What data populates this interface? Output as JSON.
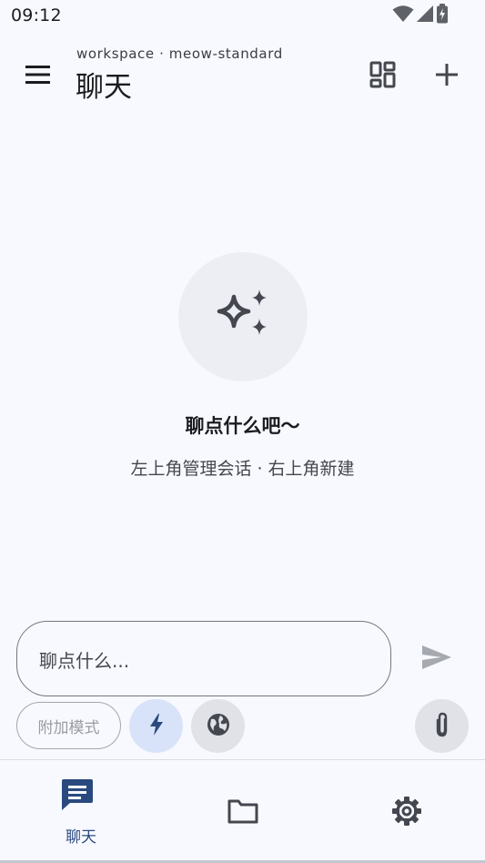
{
  "status_bar": {
    "time": "09:12",
    "icons": [
      "wifi-icon",
      "signal-icon",
      "battery-charging-icon"
    ]
  },
  "top_bar": {
    "subtitle": "workspace · meow-standard",
    "title": "聊天",
    "icons": {
      "menu": "menu-icon",
      "grid": "grid-view-icon",
      "add": "add-icon"
    }
  },
  "empty_state": {
    "icon": "sparkles-icon",
    "title": "聊点什么吧～",
    "subtitle": "左上角管理会话 · 右上角新建"
  },
  "composer": {
    "placeholder": "聊点什么...",
    "send_icon": "send-icon"
  },
  "actions": {
    "mode_chip_label": "附加模式",
    "flash_icon": "flash-icon",
    "globe_icon": "globe-icon",
    "attach_icon": "paperclip-icon"
  },
  "bottom_nav": {
    "items": [
      {
        "label": "聊天",
        "icon": "chat-icon",
        "active": true
      },
      {
        "label": "",
        "icon": "folder-icon",
        "active": false
      },
      {
        "label": "",
        "icon": "settings-icon",
        "active": false
      }
    ]
  },
  "colors": {
    "background": "#f8f9fe",
    "accent": "#2a4a7f",
    "flash_button_bg": "#d8e3fa",
    "secondary_button_bg": "#e0e2e8",
    "text_primary": "#1b1c20",
    "text_secondary": "#44474f"
  }
}
